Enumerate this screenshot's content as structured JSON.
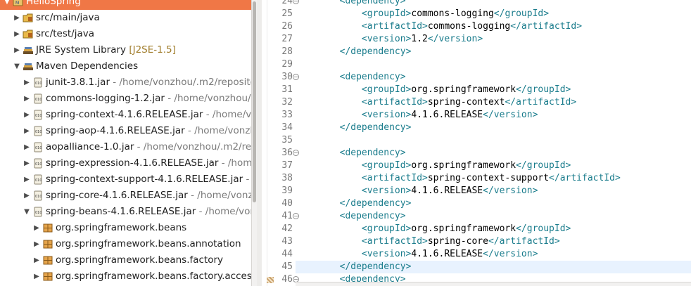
{
  "explorer": {
    "items": [
      {
        "label": "HelloSpring",
        "detail": "",
        "state": "expanded",
        "kind": "project",
        "selected": true
      },
      {
        "label": "src/main/java",
        "detail": "",
        "state": "collapsed",
        "kind": "source-folder"
      },
      {
        "label": "src/test/java",
        "detail": "",
        "state": "collapsed",
        "kind": "source-folder"
      },
      {
        "label": "JRE System Library",
        "detail": "[J2SE-1.5]",
        "state": "collapsed",
        "kind": "library"
      },
      {
        "label": "Maven Dependencies",
        "detail": "",
        "state": "expanded",
        "kind": "library"
      },
      {
        "label": "junit-3.8.1.jar",
        "detail": " - /home/vonzhou/.m2/reposito",
        "state": "collapsed",
        "kind": "jar"
      },
      {
        "label": "commons-logging-1.2.jar",
        "detail": " - /home/vonzhou/.",
        "state": "collapsed",
        "kind": "jar"
      },
      {
        "label": "spring-context-4.1.6.RELEASE.jar",
        "detail": " - /home/vo",
        "state": "collapsed",
        "kind": "jar"
      },
      {
        "label": "spring-aop-4.1.6.RELEASE.jar",
        "detail": " - /home/vonzh",
        "state": "collapsed",
        "kind": "jar"
      },
      {
        "label": "aopalliance-1.0.jar",
        "detail": " - /home/vonzhou/.m2/re",
        "state": "collapsed",
        "kind": "jar"
      },
      {
        "label": "spring-expression-4.1.6.RELEASE.jar",
        "detail": " - /home",
        "state": "collapsed",
        "kind": "jar"
      },
      {
        "label": "spring-context-support-4.1.6.RELEASE.jar",
        "detail": " - /",
        "state": "collapsed",
        "kind": "jar"
      },
      {
        "label": "spring-core-4.1.6.RELEASE.jar",
        "detail": " - /home/vonzh",
        "state": "collapsed",
        "kind": "jar"
      },
      {
        "label": "spring-beans-4.1.6.RELEASE.jar",
        "detail": " - /home/vonz",
        "state": "expanded",
        "kind": "jar"
      },
      {
        "label": "org.springframework.beans",
        "detail": "",
        "state": "collapsed",
        "kind": "package"
      },
      {
        "label": "org.springframework.beans.annotation",
        "detail": "",
        "state": "collapsed",
        "kind": "package"
      },
      {
        "label": "org.springframework.beans.factory",
        "detail": "",
        "state": "collapsed",
        "kind": "package"
      },
      {
        "label": "org.springframework.beans.factory.access",
        "detail": "",
        "state": "collapsed",
        "kind": "package"
      }
    ]
  },
  "editor": {
    "lines": [
      {
        "n": "24",
        "fold": true,
        "indent": 8,
        "tag": "dependency",
        "kind": "open"
      },
      {
        "n": "25",
        "fold": false,
        "indent": 12,
        "tag": "groupId",
        "value": "commons-logging",
        "kind": "elem"
      },
      {
        "n": "26",
        "fold": false,
        "indent": 12,
        "tag": "artifactId",
        "value": "commons-logging",
        "kind": "elem"
      },
      {
        "n": "27",
        "fold": false,
        "indent": 12,
        "tag": "version",
        "value": "1.2",
        "kind": "elem"
      },
      {
        "n": "28",
        "fold": false,
        "indent": 8,
        "tag": "dependency",
        "kind": "close"
      },
      {
        "n": "29",
        "fold": false,
        "indent": 0,
        "kind": "blank"
      },
      {
        "n": "30",
        "fold": true,
        "indent": 8,
        "tag": "dependency",
        "kind": "open"
      },
      {
        "n": "31",
        "fold": false,
        "indent": 12,
        "tag": "groupId",
        "value": "org.springframework",
        "kind": "elem"
      },
      {
        "n": "32",
        "fold": false,
        "indent": 12,
        "tag": "artifactId",
        "value": "spring-context",
        "kind": "elem"
      },
      {
        "n": "33",
        "fold": false,
        "indent": 12,
        "tag": "version",
        "value": "4.1.6.RELEASE",
        "kind": "elem"
      },
      {
        "n": "34",
        "fold": false,
        "indent": 8,
        "tag": "dependency",
        "kind": "close"
      },
      {
        "n": "35",
        "fold": false,
        "indent": 0,
        "kind": "blank"
      },
      {
        "n": "36",
        "fold": true,
        "indent": 8,
        "tag": "dependency",
        "kind": "open"
      },
      {
        "n": "37",
        "fold": false,
        "indent": 12,
        "tag": "groupId",
        "value": "org.springframework",
        "kind": "elem"
      },
      {
        "n": "38",
        "fold": false,
        "indent": 12,
        "tag": "artifactId",
        "value": "spring-context-support",
        "kind": "elem"
      },
      {
        "n": "39",
        "fold": false,
        "indent": 12,
        "tag": "version",
        "value": "4.1.6.RELEASE",
        "kind": "elem"
      },
      {
        "n": "40",
        "fold": false,
        "indent": 8,
        "tag": "dependency",
        "kind": "close"
      },
      {
        "n": "41",
        "fold": true,
        "indent": 8,
        "tag": "dependency",
        "kind": "open"
      },
      {
        "n": "42",
        "fold": false,
        "indent": 12,
        "tag": "groupId",
        "value": "org.springframework",
        "kind": "elem"
      },
      {
        "n": "43",
        "fold": false,
        "indent": 12,
        "tag": "artifactId",
        "value": "spring-core",
        "kind": "elem"
      },
      {
        "n": "44",
        "fold": false,
        "indent": 12,
        "tag": "version",
        "value": "4.1.6.RELEASE",
        "kind": "elem"
      },
      {
        "n": "45",
        "fold": false,
        "indent": 8,
        "tag": "dependency",
        "kind": "close"
      },
      {
        "n": "46",
        "fold": true,
        "indent": 8,
        "tag": "dependency",
        "kind": "open"
      }
    ],
    "current_line": "45"
  },
  "colors": {
    "selection": "#f07746",
    "xml_tag": "#1a7c8c",
    "line_number": "#787878",
    "current_line_bg": "#e8f2fe"
  }
}
